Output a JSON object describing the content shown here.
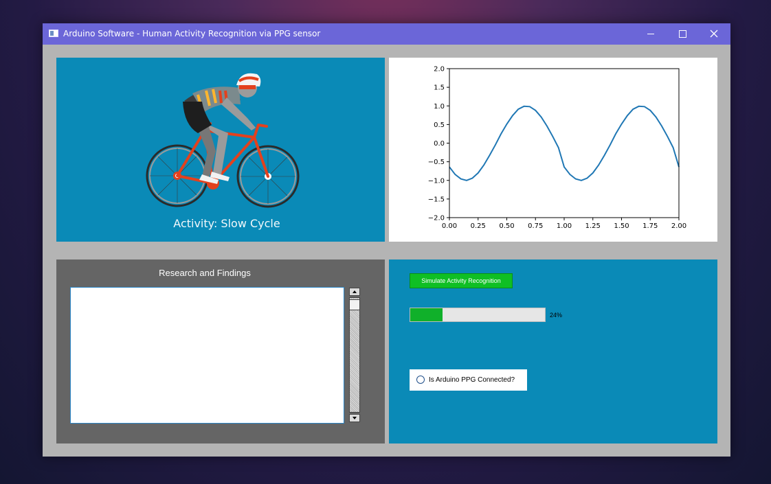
{
  "window": {
    "title": "Arduino Software - Human Activity Recognition via PPG sensor",
    "icons": [
      "minimize-icon",
      "maximize-icon",
      "close-icon"
    ]
  },
  "activity_panel": {
    "label": "Activity: Slow Cycle",
    "image": "cyclist-illustration",
    "background_color": "#0a8ab7"
  },
  "chart_data": {
    "type": "line",
    "title": "",
    "xlabel": "",
    "ylabel": "",
    "xlim": [
      0,
      2
    ],
    "ylim": [
      -2,
      2
    ],
    "x_ticks": [
      "0.00",
      "0.25",
      "0.50",
      "0.75",
      "1.00",
      "1.25",
      "1.50",
      "1.75",
      "2.00"
    ],
    "y_ticks": [
      "2.0",
      "1.5",
      "1.0",
      "0.5",
      "0.0",
      "−0.5",
      "−1.0",
      "−1.5",
      "−2.0"
    ],
    "grid": false,
    "series": [
      {
        "color": "#1f77b4",
        "x": [
          0.0,
          0.05,
          0.1,
          0.15,
          0.2,
          0.25,
          0.3,
          0.35,
          0.4,
          0.45,
          0.5,
          0.55,
          0.6,
          0.65,
          0.7,
          0.75,
          0.8,
          0.85,
          0.9,
          0.95,
          1.0,
          1.05,
          1.1,
          1.15,
          1.2,
          1.25,
          1.3,
          1.35,
          1.4,
          1.45,
          1.5,
          1.55,
          1.6,
          1.65,
          1.7,
          1.75,
          1.8,
          1.85,
          1.9,
          1.95,
          2.0
        ],
        "y": [
          -0.64,
          -0.84,
          -0.96,
          -1.0,
          -0.94,
          -0.8,
          -0.59,
          -0.33,
          -0.05,
          0.25,
          0.51,
          0.74,
          0.91,
          0.99,
          0.98,
          0.88,
          0.7,
          0.46,
          0.18,
          -0.12,
          -0.64,
          -0.84,
          -0.96,
          -1.0,
          -0.94,
          -0.8,
          -0.59,
          -0.33,
          -0.05,
          0.25,
          0.51,
          0.74,
          0.91,
          0.99,
          0.98,
          0.88,
          0.7,
          0.46,
          0.18,
          -0.12,
          -0.64
        ]
      }
    ]
  },
  "research_panel": {
    "title": "Research and Findings",
    "text": ""
  },
  "control_panel": {
    "simulate_button_label": "Simulate Activity Recognition",
    "progress_percent": 24,
    "progress_label": "24%",
    "connection_label": "Is Arduino PPG Connected?",
    "connected": false,
    "colors": {
      "button": "#0fbf24",
      "progress_fill": "#10b02a"
    }
  }
}
